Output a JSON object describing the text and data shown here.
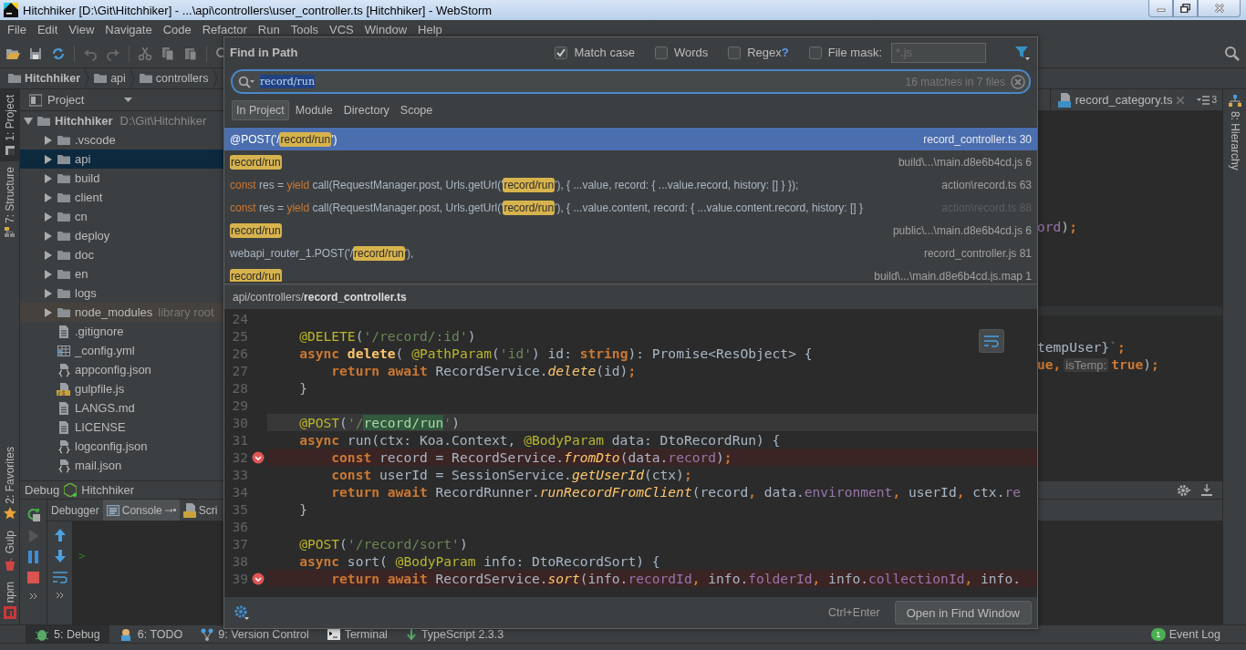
{
  "window": {
    "title": "Hitchhiker [D:\\Git\\Hitchhiker] - ...\\api\\controllers\\user_controller.ts [Hitchhiker] - WebStorm"
  },
  "menu": [
    "File",
    "Edit",
    "View",
    "Navigate",
    "Code",
    "Refactor",
    "Run",
    "Tools",
    "VCS",
    "Window",
    "Help"
  ],
  "breadcrumb": [
    "Hitchhiker",
    "api",
    "controllers"
  ],
  "left_strip_top": [
    {
      "label": "1: Project",
      "kind": "project",
      "selected": true
    },
    {
      "label": "7: Structure",
      "kind": "structure",
      "selected": false
    }
  ],
  "left_strip_bottom": [
    {
      "label": "2: Favorites",
      "kind": "favorites",
      "selected": false
    },
    {
      "label": "Gulp",
      "kind": "gulp",
      "selected": false
    },
    {
      "label": "npm",
      "kind": "npm",
      "selected": false
    }
  ],
  "right_strip": [
    {
      "label": "8: Hierarchy"
    }
  ],
  "project": {
    "title": "Project",
    "root": {
      "name": "Hitchhiker",
      "path": "D:\\Git\\Hitchhiker",
      "expanded": true,
      "children": [
        {
          "name": ".vscode",
          "kind": "folder",
          "selected": false
        },
        {
          "name": "api",
          "kind": "folder",
          "selected": true
        },
        {
          "name": "build",
          "kind": "folder",
          "selected": false
        },
        {
          "name": "client",
          "kind": "folder",
          "selected": false
        },
        {
          "name": "cn",
          "kind": "folder",
          "selected": false
        },
        {
          "name": "deploy",
          "kind": "folder",
          "selected": false
        },
        {
          "name": "doc",
          "kind": "folder",
          "selected": false
        },
        {
          "name": "en",
          "kind": "folder",
          "selected": false
        },
        {
          "name": "logs",
          "kind": "folder",
          "selected": false
        },
        {
          "name": "node_modules",
          "kind": "library",
          "note": "library root",
          "selected": false
        },
        {
          "name": ".gitignore",
          "kind": "text",
          "selected": false
        },
        {
          "name": "_config.yml",
          "kind": "table",
          "selected": false
        },
        {
          "name": "appconfig.json",
          "kind": "json",
          "selected": false
        },
        {
          "name": "gulpfile.js",
          "kind": "js",
          "selected": false
        },
        {
          "name": "LANGS.md",
          "kind": "text",
          "selected": false
        },
        {
          "name": "LICENSE",
          "kind": "text",
          "selected": false
        },
        {
          "name": "logconfig.json",
          "kind": "json",
          "selected": false
        },
        {
          "name": "mail.json",
          "kind": "json",
          "selected": false
        }
      ]
    }
  },
  "editor": {
    "tabs": [
      {
        "label": "record_category.ts",
        "selected": false
      }
    ],
    "tab_overflow_count": "3",
    "lines": [
      {
        "tokens": [
          {
            "kind": "field",
            "text": "ord"
          },
          {
            "kind": "p",
            "text": ")"
          },
          {
            "kind": "kw",
            "text": ";"
          }
        ]
      },
      {
        "tokens": [
          {
            "kind": "p",
            "text": "tempUser}"
          },
          {
            "kind": "str",
            "text": "`"
          },
          {
            "kind": "kw",
            "text": ";"
          }
        ]
      },
      {
        "tokens": [
          {
            "kind": "kw",
            "text": "ue,"
          },
          {
            "kind": "hint",
            "text": "isTemp:"
          },
          {
            "kind": "kw",
            "text": "true"
          },
          {
            "kind": "p",
            "text": ")"
          },
          {
            "kind": "kw",
            "text": ";"
          }
        ]
      }
    ]
  },
  "debug": {
    "title": "Debug",
    "config": "Hitchhiker",
    "tabs": [
      {
        "label": "Debugger",
        "selected": false
      },
      {
        "label": "Console",
        "selected": true
      },
      {
        "label": "Scri",
        "selected": false
      }
    ],
    "prompt": ">"
  },
  "bottom_tabs": [
    {
      "label": "5: Debug",
      "kind": "debug",
      "selected": true
    },
    {
      "label": "6: TODO",
      "kind": "todo",
      "selected": false
    },
    {
      "label": "9: Version Control",
      "kind": "vcs",
      "selected": false
    },
    {
      "label": "Terminal",
      "kind": "terminal",
      "selected": false
    },
    {
      "label": "TypeScript 2.3.3",
      "kind": "typescript",
      "selected": false
    }
  ],
  "event_log": {
    "label": "Event Log",
    "badge": "1"
  },
  "find": {
    "title": "Find in Path",
    "options": [
      {
        "label": "Match case",
        "checked": true
      },
      {
        "label": "Words",
        "checked": false
      },
      {
        "label": "Regex",
        "help": "?",
        "checked": false
      },
      {
        "label": "File mask:",
        "checked": false
      }
    ],
    "file_mask": {
      "placeholder": "*.js"
    },
    "query": "record/run",
    "match_count": "16 matches in 7 files",
    "scopes": [
      {
        "label": "In Project",
        "selected": true
      },
      {
        "label": "Module",
        "selected": false
      },
      {
        "label": "Directory",
        "selected": false
      },
      {
        "label": "Scope",
        "selected": false
      }
    ],
    "results": [
      {
        "segments": [
          {
            "kind": "p",
            "text": "@POST('/"
          },
          {
            "kind": "m",
            "text": "record/run"
          },
          {
            "kind": "p",
            "text": "')"
          }
        ],
        "file": "record_controller.ts 30",
        "selected": true,
        "dimmed": false
      },
      {
        "segments": [
          {
            "kind": "m",
            "text": "record/run"
          }
        ],
        "file": "build\\...\\main.d8e6b4cd.js 6",
        "selected": false,
        "dimmed": false
      },
      {
        "segments": [
          {
            "kind": "k",
            "text": "const"
          },
          {
            "kind": "p",
            "text": " res = "
          },
          {
            "kind": "k",
            "text": "yield"
          },
          {
            "kind": "p",
            "text": " call(RequestManager.post, Urls.getUrl('"
          },
          {
            "kind": "m",
            "text": "record/run"
          },
          {
            "kind": "p",
            "text": "'), { ...value, record: { ...value.record, history: [] } });"
          }
        ],
        "file": "action\\record.ts 63",
        "selected": false,
        "dimmed": false
      },
      {
        "segments": [
          {
            "kind": "k",
            "text": "const"
          },
          {
            "kind": "p",
            "text": " res = "
          },
          {
            "kind": "k",
            "text": "yield"
          },
          {
            "kind": "p",
            "text": " call(RequestManager.post, Urls.getUrl('"
          },
          {
            "kind": "m",
            "text": "record/run"
          },
          {
            "kind": "p",
            "text": "'), { ...value.content, record: { ...value.content.record, history: [] }"
          }
        ],
        "file": "action\\record.ts 88",
        "selected": false,
        "dimmed": true
      },
      {
        "segments": [
          {
            "kind": "m",
            "text": "record/run"
          }
        ],
        "file": "public\\...\\main.d8e6b4cd.js 6",
        "selected": false,
        "dimmed": false
      },
      {
        "segments": [
          {
            "kind": "p",
            "text": "webapi_router_1.POST('/"
          },
          {
            "kind": "m",
            "text": "record/run"
          },
          {
            "kind": "p",
            "text": "'),"
          }
        ],
        "file": "record_controller.js 81",
        "selected": false,
        "dimmed": false
      },
      {
        "segments": [
          {
            "kind": "m",
            "text": "record/run"
          }
        ],
        "file": "build\\...\\main.d8e6b4cd.js.map 1",
        "selected": false,
        "dimmed": false
      }
    ],
    "preview": {
      "path": "api/controllers/**record_controller.ts**",
      "lines": [
        {
          "number": "24",
          "breakpoint": false,
          "current": false
        },
        {
          "number": "25",
          "breakpoint": false,
          "current": false,
          "tokens": [
            {
              "kind": "ann",
              "text": "    @DELETE"
            },
            {
              "kind": "p",
              "text": "("
            },
            {
              "kind": "str",
              "text": "'/record/:id'"
            },
            {
              "kind": "p",
              "text": ")"
            }
          ]
        },
        {
          "number": "26",
          "breakpoint": false,
          "current": false,
          "tokens": [
            {
              "kind": "kw",
              "text": "    async"
            },
            {
              "kind": "decl",
              "text": " delete"
            },
            {
              "kind": "p",
              "text": "( "
            },
            {
              "kind": "ann",
              "text": "@PathParam"
            },
            {
              "kind": "p",
              "text": "("
            },
            {
              "kind": "str",
              "text": "'id'"
            },
            {
              "kind": "p",
              "text": ") id: "
            },
            {
              "kind": "kw",
              "text": "string"
            },
            {
              "kind": "p",
              "text": "): Promise<ResObject> {"
            }
          ]
        },
        {
          "number": "27",
          "breakpoint": false,
          "current": false,
          "tokens": [
            {
              "kind": "kw",
              "text": "        return await"
            },
            {
              "kind": "p",
              "text": " RecordService."
            },
            {
              "kind": "it",
              "text": "delete"
            },
            {
              "kind": "p",
              "text": "(id)"
            },
            {
              "kind": "kw",
              "text": ";"
            }
          ]
        },
        {
          "number": "28",
          "breakpoint": false,
          "current": false,
          "tokens": [
            {
              "kind": "p",
              "text": "    }"
            }
          ]
        },
        {
          "number": "29",
          "breakpoint": false,
          "current": false
        },
        {
          "number": "30",
          "breakpoint": false,
          "current": true,
          "tokens": [
            {
              "kind": "ann",
              "text": "    @POST"
            },
            {
              "kind": "p",
              "text": "("
            },
            {
              "kind": "str",
              "text": "'/"
            },
            {
              "kind": "hit",
              "text": "record/run"
            },
            {
              "kind": "str",
              "text": "'"
            },
            {
              "kind": "p",
              "text": ")"
            }
          ]
        },
        {
          "number": "31",
          "breakpoint": false,
          "current": false,
          "tokens": [
            {
              "kind": "kw",
              "text": "    async"
            },
            {
              "kind": "p",
              "text": " run(ctx: Koa.Context, "
            },
            {
              "kind": "ann",
              "text": "@BodyParam"
            },
            {
              "kind": "p",
              "text": " data: DtoRecordRun) {"
            }
          ]
        },
        {
          "number": "32",
          "breakpoint": true,
          "current": false,
          "tokens": [
            {
              "kind": "kw",
              "text": "        const"
            },
            {
              "kind": "p",
              "text": " record = RecordService."
            },
            {
              "kind": "it",
              "text": "fromDto"
            },
            {
              "kind": "p",
              "text": "(data."
            },
            {
              "kind": "field",
              "text": "record"
            },
            {
              "kind": "p",
              "text": ")"
            },
            {
              "kind": "kw",
              "text": ";"
            }
          ]
        },
        {
          "number": "33",
          "breakpoint": false,
          "current": false,
          "tokens": [
            {
              "kind": "kw",
              "text": "        const"
            },
            {
              "kind": "p",
              "text": " userId = SessionService."
            },
            {
              "kind": "it",
              "text": "getUserId"
            },
            {
              "kind": "p",
              "text": "(ctx)"
            },
            {
              "kind": "kw",
              "text": ";"
            }
          ]
        },
        {
          "number": "34",
          "breakpoint": false,
          "current": false,
          "tokens": [
            {
              "kind": "kw",
              "text": "        return await"
            },
            {
              "kind": "p",
              "text": " RecordRunner."
            },
            {
              "kind": "it",
              "text": "runRecordFromClient"
            },
            {
              "kind": "p",
              "text": "(record"
            },
            {
              "kind": "kw",
              "text": ","
            },
            {
              "kind": "p",
              "text": " data."
            },
            {
              "kind": "field",
              "text": "environment"
            },
            {
              "kind": "kw",
              "text": ","
            },
            {
              "kind": "p",
              "text": " userId"
            },
            {
              "kind": "kw",
              "text": ","
            },
            {
              "kind": "p",
              "text": " ctx."
            },
            {
              "kind": "field",
              "text": "re"
            }
          ]
        },
        {
          "number": "35",
          "breakpoint": false,
          "current": false,
          "tokens": [
            {
              "kind": "p",
              "text": "    }"
            }
          ]
        },
        {
          "number": "36",
          "breakpoint": false,
          "current": false
        },
        {
          "number": "37",
          "breakpoint": false,
          "current": false,
          "tokens": [
            {
              "kind": "ann",
              "text": "    @POST"
            },
            {
              "kind": "p",
              "text": "("
            },
            {
              "kind": "str",
              "text": "'/record/sort'"
            },
            {
              "kind": "p",
              "text": ")"
            }
          ]
        },
        {
          "number": "38",
          "breakpoint": false,
          "current": false,
          "tokens": [
            {
              "kind": "kw",
              "text": "    async"
            },
            {
              "kind": "p",
              "text": " sort( "
            },
            {
              "kind": "ann",
              "text": "@BodyParam"
            },
            {
              "kind": "p",
              "text": " info: DtoRecordSort) {"
            }
          ]
        },
        {
          "number": "39",
          "breakpoint": true,
          "current": false,
          "tokens": [
            {
              "kind": "kw",
              "text": "        return await"
            },
            {
              "kind": "p",
              "text": " RecordService."
            },
            {
              "kind": "it",
              "text": "sort"
            },
            {
              "kind": "p",
              "text": "(info."
            },
            {
              "kind": "field",
              "text": "recordId"
            },
            {
              "kind": "kw",
              "text": ","
            },
            {
              "kind": "p",
              "text": " info."
            },
            {
              "kind": "field",
              "text": "folderId"
            },
            {
              "kind": "kw",
              "text": ","
            },
            {
              "kind": "p",
              "text": " info."
            },
            {
              "kind": "field",
              "text": "collectionId"
            },
            {
              "kind": "kw",
              "text": ","
            },
            {
              "kind": "p",
              "text": " info."
            }
          ]
        }
      ]
    },
    "shortcut": "Ctrl+Enter",
    "open_button": "Open in Find Window"
  }
}
